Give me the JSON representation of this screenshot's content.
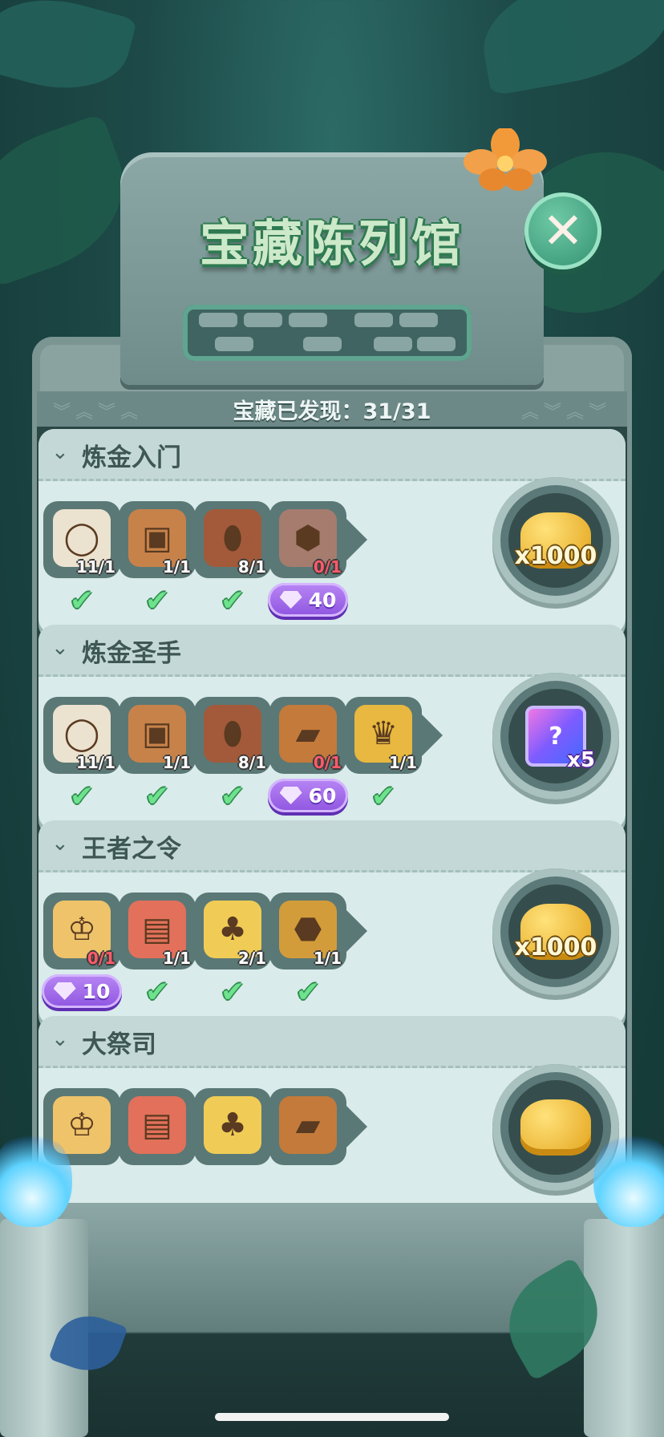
{
  "title": "宝藏陈列馆",
  "progress": {
    "label": "宝藏已发现：31/31"
  },
  "close_icon": "close-icon",
  "colors": {
    "accent_green": "#6ee28d",
    "gem_purple": "#9b61ea",
    "missing_red": "#ff5a6a",
    "count_white": "#ffffff"
  },
  "sets": [
    {
      "name": "炼金入门",
      "items": [
        {
          "icon": "bone-ring",
          "count": "11/1",
          "done": true
        },
        {
          "icon": "totem-mask",
          "count": "1/1",
          "done": true
        },
        {
          "icon": "tribal-shield",
          "count": "8/1",
          "done": true
        },
        {
          "icon": "rune-tablet",
          "count": "0/1",
          "done": false,
          "cost": "40"
        }
      ],
      "reward": {
        "type": "coins",
        "label": "x1000"
      }
    },
    {
      "name": "炼金圣手",
      "items": [
        {
          "icon": "bone-ring",
          "count": "11/1",
          "done": true
        },
        {
          "icon": "totem-mask",
          "count": "1/1",
          "done": true
        },
        {
          "icon": "tribal-shield",
          "count": "8/1",
          "done": true
        },
        {
          "icon": "spell-book",
          "count": "0/1",
          "done": false,
          "cost": "60"
        },
        {
          "icon": "golden-trophy",
          "count": "1/1",
          "done": true
        }
      ],
      "reward": {
        "type": "ticket",
        "label": "x5"
      }
    },
    {
      "name": "王者之令",
      "items": [
        {
          "icon": "crown",
          "count": "0/1",
          "done": false,
          "cost": "10"
        },
        {
          "icon": "royal-scroll",
          "count": "1/1",
          "done": true
        },
        {
          "icon": "mouse-scepter",
          "count": "2/1",
          "done": true
        },
        {
          "icon": "royal-seal",
          "count": "1/1",
          "done": true
        }
      ],
      "reward": {
        "type": "coins",
        "label": "x1000"
      }
    },
    {
      "name": "大祭司",
      "items": [
        {
          "icon": "crown",
          "count": "",
          "done": false
        },
        {
          "icon": "royal-scroll",
          "count": "",
          "done": false
        },
        {
          "icon": "mouse-scepter",
          "count": "",
          "done": false
        },
        {
          "icon": "spell-book",
          "count": "",
          "done": false
        }
      ],
      "reward": {
        "type": "coins",
        "label": ""
      }
    }
  ]
}
